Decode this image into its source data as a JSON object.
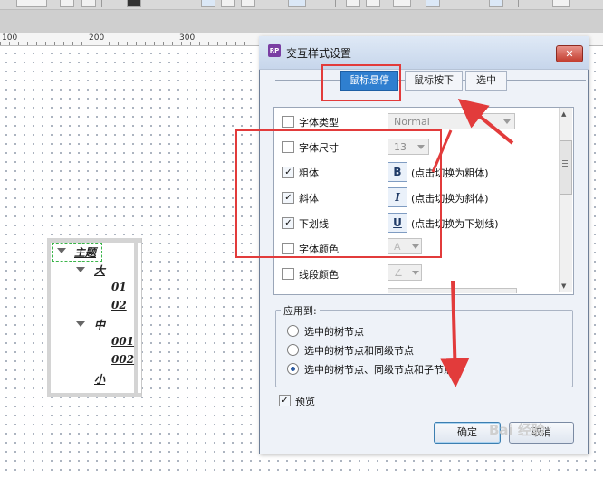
{
  "ruler": {
    "labels": [
      "100",
      "200",
      "300"
    ]
  },
  "tree": {
    "nodes": [
      {
        "label": "主题",
        "expandable": true
      },
      {
        "label": "大",
        "expandable": true
      },
      {
        "label": "01",
        "expandable": false
      },
      {
        "label": "02",
        "expandable": false
      },
      {
        "label": "中",
        "expandable": true
      },
      {
        "label": "001",
        "expandable": false
      },
      {
        "label": "002",
        "expandable": false
      },
      {
        "label": "小",
        "expandable": false
      }
    ]
  },
  "dialog": {
    "app_icon": "RP",
    "title": "交互样式设置",
    "close_glyph": "✕",
    "tabs": [
      {
        "label": "鼠标悬停",
        "active": true
      },
      {
        "label": "鼠标按下",
        "active": false
      },
      {
        "label": "选中",
        "active": false
      }
    ],
    "properties": [
      {
        "label": "字体类型",
        "checked": false,
        "control": "combo",
        "value": "Normal"
      },
      {
        "label": "字体尺寸",
        "checked": false,
        "control": "combo",
        "value": "13"
      },
      {
        "label": "粗体",
        "checked": true,
        "control": "button",
        "glyph": "B",
        "hint": "(点击切换为粗体)"
      },
      {
        "label": "斜体",
        "checked": true,
        "control": "button",
        "glyph": "I",
        "hint": "(点击切换为斜体)"
      },
      {
        "label": "下划线",
        "checked": true,
        "control": "button",
        "glyph": "U",
        "hint": "(点击切换为下划线)"
      },
      {
        "label": "字体颜色",
        "checked": false,
        "control": "color",
        "glyph": "A"
      },
      {
        "label": "线段颜色",
        "checked": false,
        "control": "color",
        "glyph": "∠"
      }
    ],
    "apply_to": {
      "title": "应用到:",
      "options": [
        {
          "label": "选中的树节点",
          "selected": false
        },
        {
          "label": "选中的树节点和同级节点",
          "selected": false
        },
        {
          "label": "选中的树节点、同级节点和子节点",
          "selected": true
        }
      ]
    },
    "preview": {
      "label": "预览",
      "checked": true
    },
    "buttons": {
      "ok": "确定",
      "cancel": "取消"
    }
  },
  "colors": {
    "accent": "#2f7fd0",
    "annotation": "#e23b3b",
    "close": "#c33d2f"
  },
  "watermark": "Bai 经验"
}
